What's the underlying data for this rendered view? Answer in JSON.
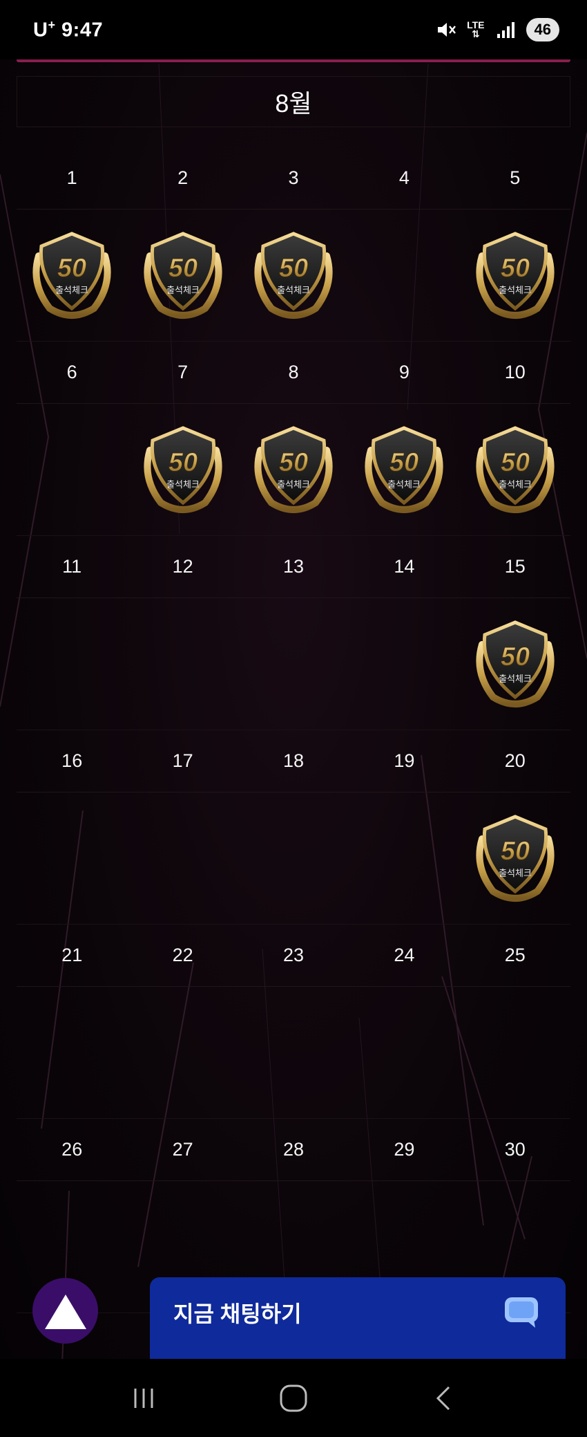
{
  "status_bar": {
    "carrier": "U",
    "carrier_sup": "+",
    "time": "9:47",
    "network": "LTE",
    "battery": "46",
    "icons": [
      "mute-icon",
      "lte-icon",
      "signal-icon",
      "battery-icon"
    ]
  },
  "calendar": {
    "month": "8월",
    "badge_text": "출석체크",
    "badge_number": "50",
    "weeks": [
      {
        "dates": [
          "1",
          "2",
          "3",
          "4",
          "5"
        ],
        "stamped": [
          true,
          true,
          true,
          false,
          true
        ]
      },
      {
        "dates": [
          "6",
          "7",
          "8",
          "9",
          "10"
        ],
        "stamped": [
          false,
          true,
          true,
          true,
          true
        ]
      },
      {
        "dates": [
          "11",
          "12",
          "13",
          "14",
          "15"
        ],
        "stamped": [
          false,
          false,
          false,
          false,
          true
        ]
      },
      {
        "dates": [
          "16",
          "17",
          "18",
          "19",
          "20"
        ],
        "stamped": [
          false,
          false,
          false,
          false,
          true
        ]
      },
      {
        "dates": [
          "21",
          "22",
          "23",
          "24",
          "25"
        ],
        "stamped": [
          false,
          false,
          false,
          false,
          false
        ]
      },
      {
        "dates": [
          "26",
          "27",
          "28",
          "29",
          "30"
        ],
        "stamped": [
          false,
          false,
          false,
          false,
          false
        ]
      }
    ]
  },
  "chat": {
    "label": "지금 채팅하기",
    "icon": "chat-bubble-icon"
  },
  "scroll_top": {
    "icon": "triangle-up-icon"
  },
  "nav": {
    "icons": [
      "recent-apps-icon",
      "home-icon",
      "back-icon"
    ]
  },
  "colors": {
    "accent_bar": "#8a1e4e",
    "chat_bg": "#0f2a9a",
    "fab_bg": "#3a0e68",
    "gold": "#c9a14a"
  }
}
